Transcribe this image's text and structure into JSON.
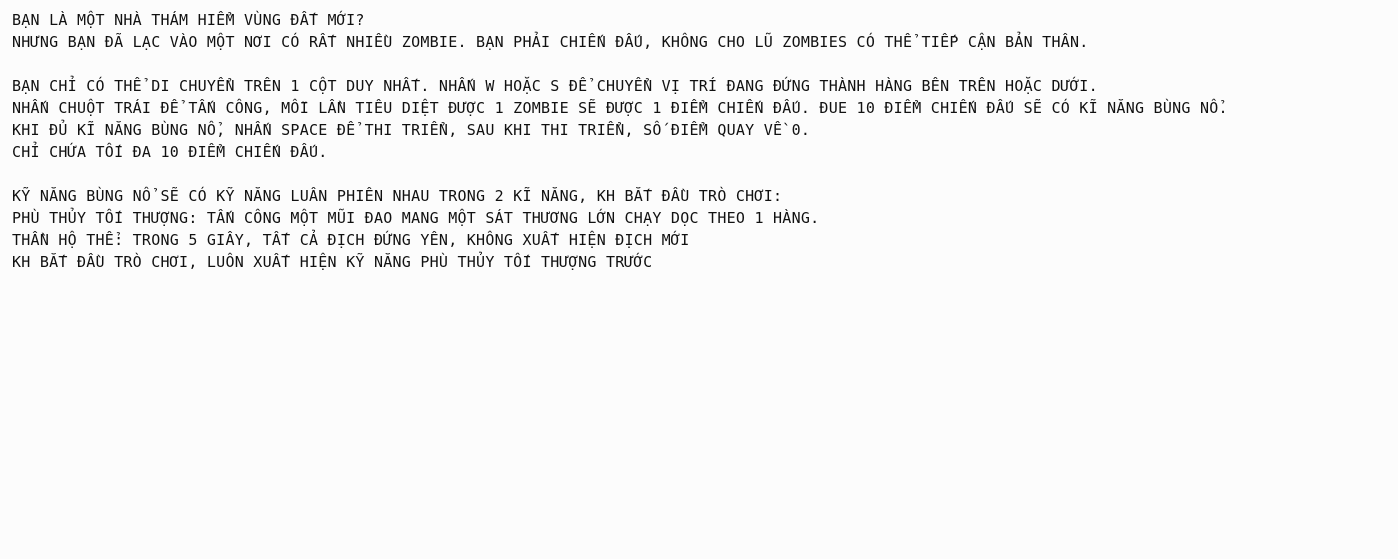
{
  "instructions": {
    "intro": [
      "BẠN LÀ MỘT NHÀ THÁM HIỂM VÙNG ĐẤT MỚI?",
      "NHƯNG BẠN ĐÃ LẠC VÀO MỘT NƠI CÓ RẤT NHIỀU ZOMBIE. BẠN PHẢI CHIẾN ĐẤU, KHÔNG CHO LŨ ZOMBIES CÓ THỂ TIẾP CẬN BẢN THÂN."
    ],
    "controls": [
      "BẠN CHỈ CÓ THỂ DI CHUYỂN TRÊN 1 CỘT DUY NHẤT. NHẤN W HOẶC S ĐỂ CHUYỂN VỊ TRÍ ĐANG ĐỨNG THÀNH HÀNG BÊN TRÊN HOẶC DƯỚI.",
      "NHẤN CHUỘT TRÁI ĐỂ TẤN CÔNG, MỖI LẦN TIÊU DIỆT ĐƯỢC 1 ZOMBIE SẼ ĐƯỢC 1 ĐIỂM CHIẾN ĐẤU. ĐUE 10 ĐIỂM CHIẾN ĐẤU SẼ CÓ KĨ NĂNG BÙNG NỔ.",
      "KHI ĐỦ KĨ NĂNG BÙNG NỔ, NHẤN SPACE ĐỂ THI TRIỂN, SAU KHI THI TRIỂN, SỐ ĐIỂM QUAY VỀ 0.",
      "CHỈ CHỨA TỐI ĐA 10 ĐIỂM CHIẾN ĐẤU."
    ],
    "skills": [
      "KỸ NĂNG BÙNG NỔ SẼ CÓ KỸ NĂNG LUÂN PHIÊN NHAU TRONG 2 KĨ NĂNG, KH BẮT ĐẦU TRÒ CHƠI:",
      "PHÙ THỦY TỐI THƯỢNG: TẤN CÔNG MỘT MŨI ĐAO MANG MỘT SÁT THƯƠNG LỚN CHẠY DỌC THEO 1 HÀNG.",
      "THẦN HỘ THỂ: TRONG 5 GIÂY, TẤT CẢ ĐỊCH ĐỨNG YÊN, KHÔNG XUẤT HIỆN ĐỊCH MỚI",
      "KH BẮT ĐẦU TRÒ CHƠI, LUÔN XUẤT HIỆN KỸ NĂNG PHÙ THỦY TỐI THƯỢNG TRƯỚC"
    ]
  },
  "colors": {
    "background": "#fcfcfc",
    "text": "#111111"
  }
}
